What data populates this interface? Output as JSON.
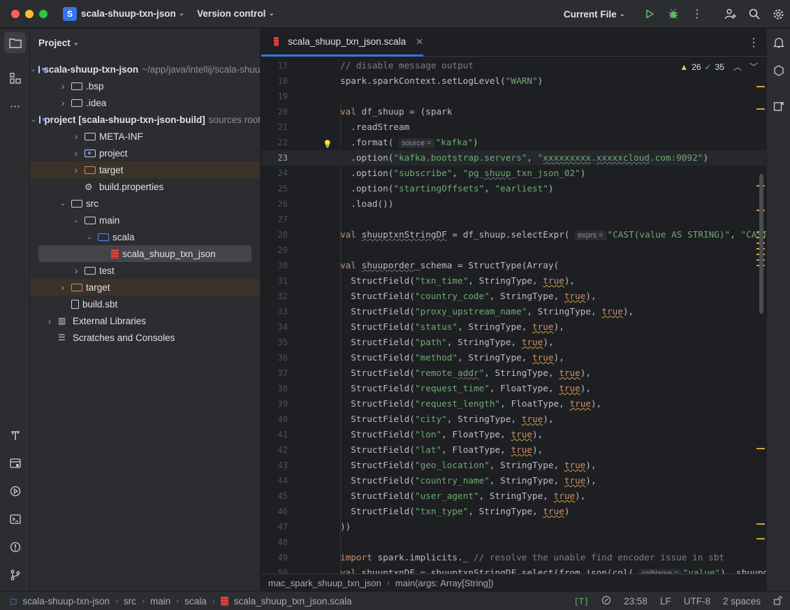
{
  "titlebar": {
    "project_initial": "S",
    "project_name": "scala-shuup-txn-json",
    "vcs_label": "Version control",
    "run_config": "Current File"
  },
  "project_panel": {
    "title": "Project",
    "tree": [
      {
        "label": "scala-shuup-txn-json",
        "hint": "~/app/java/intellij/scala-shuup-txn-json",
        "icon": "module-folder",
        "indent": 0,
        "expanded": true,
        "bold": true
      },
      {
        "label": ".bsp",
        "icon": "folder",
        "indent": 1,
        "expanded": false
      },
      {
        "label": ".idea",
        "icon": "folder",
        "indent": 1,
        "expanded": false
      },
      {
        "label": "project [scala-shuup-txn-json-build]",
        "hint": "sources root",
        "icon": "module-folder",
        "indent": 1,
        "expanded": true,
        "bold": true
      },
      {
        "label": "META-INF",
        "icon": "folder",
        "indent": 2,
        "expanded": false
      },
      {
        "label": "project",
        "icon": "module-folder",
        "indent": 2,
        "expanded": false
      },
      {
        "label": "target",
        "icon": "excluded-folder",
        "indent": 2,
        "expanded": false,
        "excluded": true
      },
      {
        "label": "build.properties",
        "icon": "settings-file",
        "indent": 2,
        "leaf": true
      },
      {
        "label": "src",
        "icon": "folder",
        "indent": 1,
        "expanded": true
      },
      {
        "label": "main",
        "icon": "folder",
        "indent": 2,
        "expanded": true
      },
      {
        "label": "scala",
        "icon": "source-folder",
        "indent": 3,
        "expanded": true
      },
      {
        "label": "scala_shuup_txn_json",
        "icon": "scala-file",
        "indent": 4,
        "leaf": true,
        "selected": true
      },
      {
        "label": "test",
        "icon": "folder",
        "indent": 2,
        "expanded": false
      },
      {
        "label": "target",
        "icon": "excluded-folder",
        "indent": 1,
        "expanded": false,
        "excluded": true
      },
      {
        "label": "build.sbt",
        "icon": "file",
        "indent": 1,
        "leaf": true
      },
      {
        "label": "External Libraries",
        "icon": "libraries",
        "indent": 0,
        "expanded": false
      },
      {
        "label": "Scratches and Consoles",
        "icon": "scratches",
        "indent": 0,
        "leaf": true
      }
    ]
  },
  "editor": {
    "tab_label": "scala_shuup_txn_json.scala",
    "warnings": "26",
    "weak_warnings": "35",
    "breadcrumb": [
      "mac_spark_shuup_txn_json",
      "main(args: Array[String])"
    ],
    "lines": [
      {
        "n": "17",
        "html": "<span class=\"cm\">// disable message output</span>",
        "i": 2
      },
      {
        "n": "18",
        "html": "spark.sparkContext.setLogLevel(<span class=\"str\">\"WARN\"</span>)",
        "i": 2
      },
      {
        "n": "19",
        "html": "",
        "i": 2
      },
      {
        "n": "20",
        "html": "<span class=\"kw\">val</span> df_shuup = (spark",
        "i": 2
      },
      {
        "n": "21",
        "html": "  .readStream",
        "i": 2
      },
      {
        "n": "22",
        "html": "  .format( <span class=\"hint\">source =</span><span class=\"str\">\"kafka\"</span>)",
        "i": 2,
        "bulb": true
      },
      {
        "n": "23",
        "html": "  .option(<span class=\"str\">\"kafka.bootstrap.servers\"</span>, <span class=\"str\">\"<span class=\"ug\">xxxxxxxxx</span>.<span class=\"ug\">xxxxxcloud</span>.com:9092\"</span>)",
        "i": 2,
        "current": true
      },
      {
        "n": "24",
        "html": "  .option(<span class=\"str\">\"subscribe\"</span>, <span class=\"str\">\"pg_<span class=\"ug\">shuup</span>_txn_json_02\"</span>)",
        "i": 2
      },
      {
        "n": "25",
        "html": "  .option(<span class=\"str\">\"startingOffsets\"</span>, <span class=\"str\">\"earliest\"</span>)",
        "i": 2
      },
      {
        "n": "26",
        "html": "  .load())",
        "i": 2
      },
      {
        "n": "27",
        "html": "",
        "i": 2
      },
      {
        "n": "28",
        "html": "<span class=\"kw\">val</span> <span class=\"ug\">shuuptxnStringDF</span> = df_shuup.selectExpr( <span class=\"hint\">exprs =</span><span class=\"str\">\"CAST(value AS STRING)\"</span>, <span class=\"str\">\"CAST(timestamp AS TIMESTAMP)\"</span>)",
        "i": 2
      },
      {
        "n": "29",
        "html": "",
        "i": 2
      },
      {
        "n": "30",
        "html": "<span class=\"kw\">val</span> <span class=\"ug\">shuuporder</span>_schema = StructType(Array(",
        "i": 2
      },
      {
        "n": "31",
        "html": "  StructField(<span class=\"str\">\"txn_time\"</span>, StringType, <span class=\"kw u\">true</span>),",
        "i": 2
      },
      {
        "n": "32",
        "html": "  StructField(<span class=\"str\">\"country_code\"</span>, StringType, <span class=\"kw u\">true</span>),",
        "i": 2
      },
      {
        "n": "33",
        "html": "  StructField(<span class=\"str\">\"proxy_upstream_name\"</span>, StringType, <span class=\"kw u\">true</span>),",
        "i": 2
      },
      {
        "n": "34",
        "html": "  StructField(<span class=\"str\">\"status\"</span>, StringType, <span class=\"kw u\">true</span>),",
        "i": 2
      },
      {
        "n": "35",
        "html": "  StructField(<span class=\"str\">\"path\"</span>, StringType, <span class=\"kw u\">true</span>),",
        "i": 2
      },
      {
        "n": "36",
        "html": "  StructField(<span class=\"str\">\"method\"</span>, StringType, <span class=\"kw u\">true</span>),",
        "i": 2
      },
      {
        "n": "37",
        "html": "  StructField(<span class=\"str\">\"remote_<span class=\"ug\">addr</span>\"</span>, StringType, <span class=\"kw u\">true</span>),",
        "i": 2
      },
      {
        "n": "38",
        "html": "  StructField(<span class=\"str\">\"request_time\"</span>, FloatType, <span class=\"kw u\">true</span>),",
        "i": 2
      },
      {
        "n": "39",
        "html": "  StructField(<span class=\"str\">\"request_length\"</span>, FloatType, <span class=\"kw u\">true</span>),",
        "i": 2
      },
      {
        "n": "40",
        "html": "  StructField(<span class=\"str\">\"city\"</span>, StringType, <span class=\"kw u\">true</span>),",
        "i": 2
      },
      {
        "n": "41",
        "html": "  StructField(<span class=\"str\">\"lon\"</span>, FloatType, <span class=\"kw u\">true</span>),",
        "i": 2
      },
      {
        "n": "42",
        "html": "  StructField(<span class=\"str\">\"lat\"</span>, FloatType, <span class=\"kw u\">true</span>),",
        "i": 2
      },
      {
        "n": "43",
        "html": "  StructField(<span class=\"str\">\"geo_location\"</span>, StringType, <span class=\"kw u\">true</span>),",
        "i": 2
      },
      {
        "n": "44",
        "html": "  StructField(<span class=\"str\">\"country_name\"</span>, StringType, <span class=\"kw u\">true</span>),",
        "i": 2
      },
      {
        "n": "45",
        "html": "  StructField(<span class=\"str\">\"user_agent\"</span>, StringType, <span class=\"kw u\">true</span>),",
        "i": 2
      },
      {
        "n": "46",
        "html": "  StructField(<span class=\"str\">\"txn_type\"</span>, StringType, <span class=\"kw u\">true</span>)",
        "i": 2
      },
      {
        "n": "47",
        "html": "))",
        "i": 2
      },
      {
        "n": "48",
        "html": "",
        "i": 2
      },
      {
        "n": "49",
        "html": "<span class=\"kw\">import</span> spark.implicits._ <span class=\"cm\">// resolve the unable find encoder issue in sbt</span>",
        "i": 2
      },
      {
        "n": "50",
        "html": "<span class=\"kw\">val</span> shuuptxnDF = shuuptxnStringDF.select(from_json(col( <span class=\"hint\">colName =</span><span class=\"str\">\"value\"</span>), shuuporder_schema)",
        "i": 2
      }
    ]
  },
  "statusbar": {
    "crumbs": [
      "scala-shuup-txn-json",
      "src",
      "main",
      "scala",
      "scala_shuup_txn_json.scala"
    ],
    "mode": "[T]",
    "position": "23:58",
    "line_sep": "LF",
    "encoding": "UTF-8",
    "indent": "2 spaces"
  }
}
